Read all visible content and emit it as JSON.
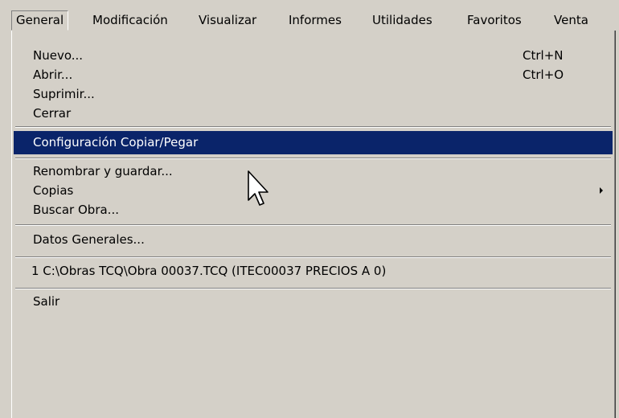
{
  "menubar": {
    "items": [
      {
        "label": "General"
      },
      {
        "label": "Modificación"
      },
      {
        "label": "Visualizar"
      },
      {
        "label": "Informes"
      },
      {
        "label": "Utilidades"
      },
      {
        "label": "Favoritos"
      },
      {
        "label": "Venta"
      }
    ]
  },
  "menu": {
    "nuevo": {
      "label": "Nuevo...",
      "shortcut": "Ctrl+N"
    },
    "abrir": {
      "label": "Abrir...",
      "shortcut": "Ctrl+O"
    },
    "suprimir": {
      "label": "Suprimir..."
    },
    "cerrar": {
      "label": "Cerrar"
    },
    "config": {
      "label": "Configuración Copiar/Pegar"
    },
    "renombrar": {
      "label": "Renombrar y guardar..."
    },
    "copias": {
      "label": "Copias"
    },
    "buscar": {
      "label": "Buscar Obra..."
    },
    "datos": {
      "label": "Datos Generales..."
    },
    "reciente": {
      "label": "1 C:\\Obras TCQ\\Obra  00037.TCQ (ITEC00037 PRECIOS A 0)"
    },
    "salir": {
      "label": "Salir"
    }
  },
  "colors": {
    "menu_bg": "#d4d0c8",
    "highlight_bg": "#0a246a",
    "highlight_text": "#ffffff"
  }
}
